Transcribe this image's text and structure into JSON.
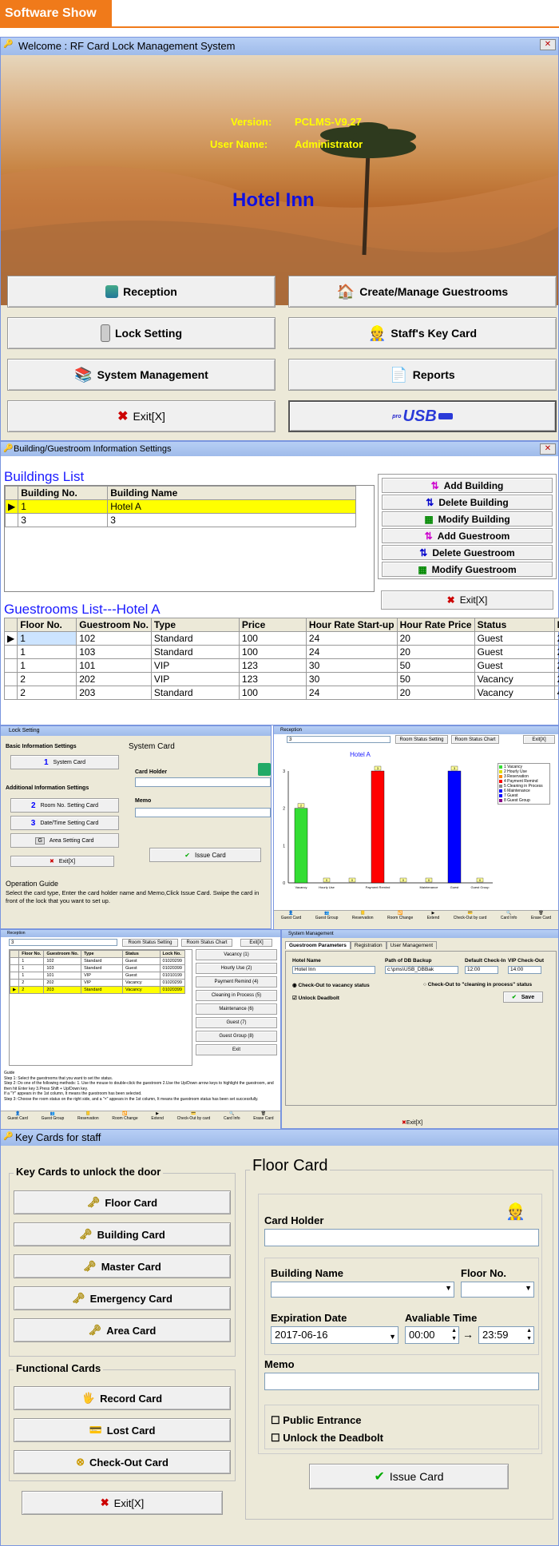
{
  "banner": {
    "title": "Software Show"
  },
  "welcome": {
    "title": "Welcome :  RF Card Lock Management System",
    "version_label": "Version:",
    "version_value": "PCLMS-V9.27",
    "user_label": "User Name:",
    "user_value": "Administrator",
    "hotel": "Hotel Inn",
    "buttons": [
      "Reception",
      "Create/Manage Guestrooms",
      "Lock Setting",
      "Staff's Key Card",
      "System Management",
      "Reports",
      "Exit[X]"
    ],
    "usb_label": "USB",
    "usb_small": "pro"
  },
  "building": {
    "title": "Building/Guestroom Information Settings",
    "buildings_heading": "Buildings List",
    "bcols": [
      "Building No.",
      "Building Name"
    ],
    "brows": [
      [
        "1",
        "Hotel A"
      ],
      [
        "3",
        "3"
      ]
    ],
    "actions": [
      "Add Building",
      "Delete Building",
      "Modify Building",
      "Add Guestroom",
      "Delete Guestroom",
      "Modify Guestroom"
    ],
    "exit": "Exit[X]",
    "guestrooms_heading": "Guestrooms List---Hotel A",
    "gcols": [
      "Floor No.",
      "Guestroom No.",
      "Type",
      "Price",
      "Hour Rate Start-up",
      "Hour Rate Price",
      "Status",
      "Ma"
    ],
    "grows": [
      [
        "1",
        "102",
        "Standard",
        "100",
        "24",
        "20",
        "Guest",
        "2"
      ],
      [
        "1",
        "103",
        "Standard",
        "100",
        "24",
        "20",
        "Guest",
        "2"
      ],
      [
        "1",
        "101",
        "VIP",
        "123",
        "30",
        "50",
        "Guest",
        "2"
      ],
      [
        "2",
        "202",
        "VIP",
        "123",
        "30",
        "50",
        "Vacancy",
        "2"
      ],
      [
        "2",
        "203",
        "Standard",
        "100",
        "24",
        "20",
        "Vacancy",
        "4"
      ]
    ]
  },
  "lock": {
    "title": "Lock Setting",
    "basic": "Basic Information Settings",
    "system_card": "System Card",
    "additional": "Additional Information Settings",
    "room_no": "Room No. Setting Card",
    "datetime": "Date/Time Setting Card",
    "area": "Area Setting Card",
    "exit": "Exit[X]",
    "syscard_heading": "System Card",
    "holder": "Card Holder",
    "memo": "Memo",
    "issue": "Issue Card",
    "guide": "Operation Guide",
    "guide_text": "Select the card type, Enter the card holder name and Memo,Click Issue Card. Swipe the card in front of the  lock that you want to set up."
  },
  "chartwin": {
    "title": "Reception",
    "select": "3",
    "rss": "Room Status Setting",
    "rsc": "Room Status Chart",
    "exit": "Exit[X]",
    "legend": [
      "1 Vacancy",
      "2 Hourly Use",
      "3 Reservation",
      "4 Payment Remind",
      "5 Cleaning in Process",
      "6 Maintenance",
      "7 Guest",
      "8 Guest Group"
    ],
    "tools": [
      "Guest Card",
      "Guest Group",
      "Reservation",
      "Room Change",
      "Extend",
      "Check-Out by card",
      "Card Info",
      "Erase Card"
    ]
  },
  "chart_data": {
    "type": "bar",
    "title": "Hotel A",
    "categories": [
      "Vacancy",
      "Hourly Use",
      "Reservation",
      "Payment Remind",
      "Cleaning in Process",
      "Maintenance",
      "Guest",
      "Guest Group"
    ],
    "values": [
      2,
      0,
      0,
      3,
      0,
      0,
      3,
      0
    ],
    "colors": [
      "#33dd33",
      "#dddd00",
      "#ff8800",
      "#ff0000",
      "#888888",
      "#0000ff",
      "#0000ff",
      "#880088"
    ],
    "ylim": [
      0,
      3
    ],
    "yticks": [
      "0",
      "1",
      "2",
      "3"
    ],
    "xticklabels": [
      "Vacancy",
      "Hourly Use",
      "Payment Remind",
      "Maintenance",
      "Guest",
      "Guest Group"
    ]
  },
  "recep2": {
    "title": "Reception",
    "select": "3",
    "rss": "Room Status Setting",
    "rsc": "Room Status Chart",
    "exit": "Exit[X]",
    "cols": [
      "Floor No.",
      "Guestroom No.",
      "Type",
      "Status",
      "Lock No."
    ],
    "rows": [
      [
        "1",
        "102",
        "Standard",
        "Guest",
        "01020299"
      ],
      [
        "1",
        "103",
        "Standard",
        "Guest",
        "01020399"
      ],
      [
        "1",
        "101",
        "VIP",
        "Guest",
        "01010199"
      ],
      [
        "2",
        "202",
        "VIP",
        "Vacancy",
        "01020299"
      ],
      [
        "2",
        "203",
        "Standard",
        "Vacancy",
        "01020399"
      ]
    ],
    "side": [
      "Vacancy (1)",
      "Hourly Use (2)",
      "Payment Remind (4)",
      "Cleaning in Process (5)",
      "Maintenance (6)",
      "Guest (7)",
      "Guest Group (8)",
      "Exit"
    ],
    "guide": "Guide",
    "g1": "Step 1: Select the guestrooms that you want to set the status.",
    "g2": "Step 2: Do one of the following methods: 1. Use the mouse to double-click the guestroom 2.Use the Up/Down arrow keys to highlight the guestroom, and then hit Enter key 3.Press Shift + Up/Down key.",
    "g3": "If a \"Y\" appears in the 1st column, It means the guestroom has been selected.",
    "g4": "Step 3: Choose the room status on the right side, and a \"×\" appears in the 1st column, It means the guestroom status has been set successfully.",
    "tools": [
      "Guest Card",
      "Guest Group",
      "Reservation",
      "Room Change",
      "Extend",
      "Check-Out by card",
      "Card Info",
      "Erase Card"
    ]
  },
  "sysmgmt": {
    "title": "System Management",
    "tabs": [
      "Guestroom Parameters",
      "Registration",
      "User Management"
    ],
    "hotel_label": "Hotel Name",
    "hotel_value": "Hotel Inn",
    "path_label": "Path of DB Backup",
    "path_value": "c:\\pms\\USB_DBBak",
    "checkin_label": "Default Check-In",
    "checkin_value": "12:00",
    "vip_label": "VIP Check-Out",
    "vip_value": "14:00",
    "r1": "Check-Out to vacancy status",
    "r2": "Check-Out to \"cleaning in process\" status",
    "unlock": "Unlock Deadbolt",
    "save": "Save",
    "exit": "Exit[X]"
  },
  "staff": {
    "title": "Key Cards for staff",
    "unlock_group": "Key Cards to unlock the door",
    "cards": [
      "Floor Card",
      "Building Card",
      "Master Card",
      "Emergency Card",
      "Area Card"
    ],
    "func_group": "Functional Cards",
    "func": [
      "Record Card",
      "Lost Card",
      "Check-Out Card"
    ],
    "exit": "Exit[X]",
    "floor_heading": "Floor Card",
    "holder": "Card Holder",
    "bname": "Building Name",
    "floorno": "Floor No.",
    "exp": "Expiration Date",
    "exp_value": "2017-06-16",
    "avail": "Avaliable Time",
    "t1": "00:00",
    "arrow": "→",
    "t2": "23:59",
    "memo": "Memo",
    "public": "Public Entrance",
    "unlock": "Unlock the Deadbolt",
    "issue": "Issue Card"
  }
}
